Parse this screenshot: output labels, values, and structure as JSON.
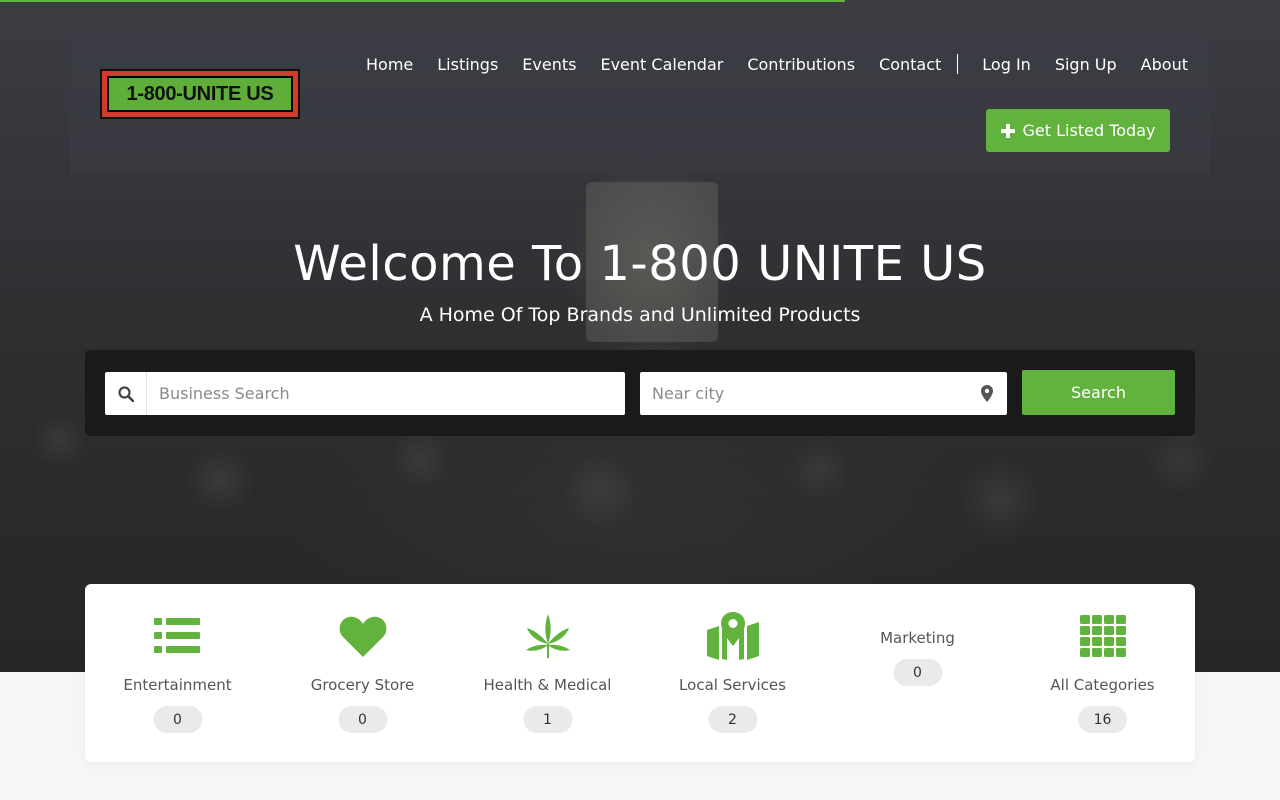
{
  "brand": {
    "logo_text": "1-800-UNITE US",
    "accent_color": "#61b33d",
    "logo_red": "#d33b2f"
  },
  "nav": {
    "items": [
      "Home",
      "Listings",
      "Events",
      "Event Calendar",
      "Contributions",
      "Contact"
    ],
    "account_items": [
      "Log In",
      "Sign Up",
      "About"
    ],
    "cta_label": "Get Listed Today"
  },
  "hero": {
    "title": "Welcome To 1-800 UNITE US",
    "subtitle": "A Home Of Top Brands and Unlimited Products"
  },
  "search": {
    "business_placeholder": "Business Search",
    "city_placeholder": "Near city",
    "button_label": "Search"
  },
  "categories": [
    {
      "name": "Entertainment",
      "count": "0",
      "icon": "list-icon"
    },
    {
      "name": "Grocery Store",
      "count": "0",
      "icon": "heart-icon"
    },
    {
      "name": "Health & Medical",
      "count": "1",
      "icon": "cannabis-leaf-icon"
    },
    {
      "name": "Local Services",
      "count": "2",
      "icon": "map-pin-icon"
    },
    {
      "name": "Marketing",
      "count": "0",
      "icon": ""
    },
    {
      "name": "All Categories",
      "count": "16",
      "icon": "grid-icon"
    }
  ],
  "page_load_progress": 0.66
}
